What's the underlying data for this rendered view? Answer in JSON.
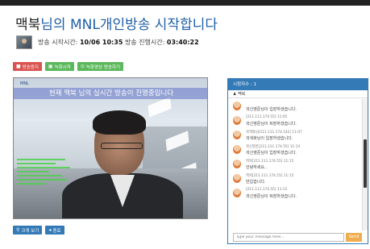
{
  "header": {
    "user_name": "맥북",
    "title_suffix": "님의 MNL개인방송 시작합니다"
  },
  "broadcast_meta": {
    "start_label": "방송 시작시간:",
    "start_value": "10/06 10:35",
    "elapsed_label": "방송 진행시간:",
    "elapsed_value": "03:40:22"
  },
  "toolbar": {
    "stop_label": "방송중지",
    "record_label": "녹화시작",
    "record_broadcast_label": "녹화영상 방송하기"
  },
  "video": {
    "brand": "MNL",
    "caption": "현재 맥북 님의 실시간 방송이 진행중입니다"
  },
  "bottom_buttons": {
    "zoom_label": "크게 보기",
    "close_label": "종료"
  },
  "chat": {
    "header": "시청자수 : 1",
    "viewer_label": "맥북",
    "messages": [
      {
        "meta": "",
        "text": "곽신영준님이 입장하셨습니다."
      },
      {
        "meta": "[211.111.174.55] 11:05",
        "text": "곽신영준님이 퇴장하셨습니다."
      },
      {
        "meta": "곽색화님[211.111.174.142] 11:07",
        "text": "곽색화님이 입장하셨습니다."
      },
      {
        "meta": "곽신영준[211.111.174.55] 11:14",
        "text": "곽신영준님이 입장하셨습니다."
      },
      {
        "meta": "맥북[211.111.174.55] 11:15",
        "text": "안녕하세요.."
      },
      {
        "meta": "맥북[211.111.174.55] 11:15",
        "text": "반갑습니다."
      },
      {
        "meta": "[211.111.174.55] 11:15",
        "text": "곽신영준님이 퇴장하셨습니다."
      }
    ],
    "input_placeholder": "Type your message here...",
    "send_label": "Send"
  },
  "colors": {
    "title_blue": "#1f5fa8",
    "stop_red": "#d9534f",
    "record_green": "#5cb85c",
    "panel_blue": "#337ab7",
    "send_orange": "#f0ad4e"
  }
}
